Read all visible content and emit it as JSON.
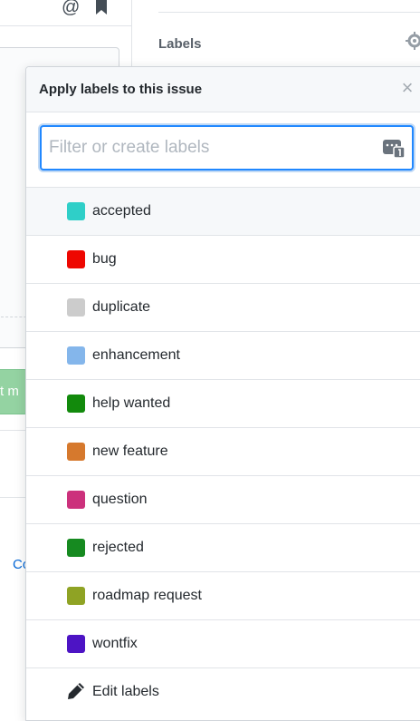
{
  "background": {
    "sidebar_heading": "Labels",
    "merge_button_fragment": "t m",
    "link_fragment": "Co"
  },
  "popover": {
    "title": "Apply labels to this issue",
    "close_glyph": "×",
    "filter": {
      "placeholder": "Filter or create labels",
      "value": ""
    },
    "labels": [
      {
        "name": "accepted",
        "color": "#2fcfc8",
        "highlighted": true
      },
      {
        "name": "bug",
        "color": "#ee0701",
        "highlighted": false
      },
      {
        "name": "duplicate",
        "color": "#cccccc",
        "highlighted": false
      },
      {
        "name": "enhancement",
        "color": "#84b6eb",
        "highlighted": false
      },
      {
        "name": "help wanted",
        "color": "#128a0c",
        "highlighted": false
      },
      {
        "name": "new feature",
        "color": "#d6792d",
        "highlighted": false
      },
      {
        "name": "question",
        "color": "#cc317c",
        "highlighted": false
      },
      {
        "name": "rejected",
        "color": "#168a20",
        "highlighted": false
      },
      {
        "name": "roadmap request",
        "color": "#8fa324",
        "highlighted": false
      },
      {
        "name": "wontfix",
        "color": "#4d14c4",
        "highlighted": false
      }
    ],
    "edit_labels": "Edit labels"
  }
}
